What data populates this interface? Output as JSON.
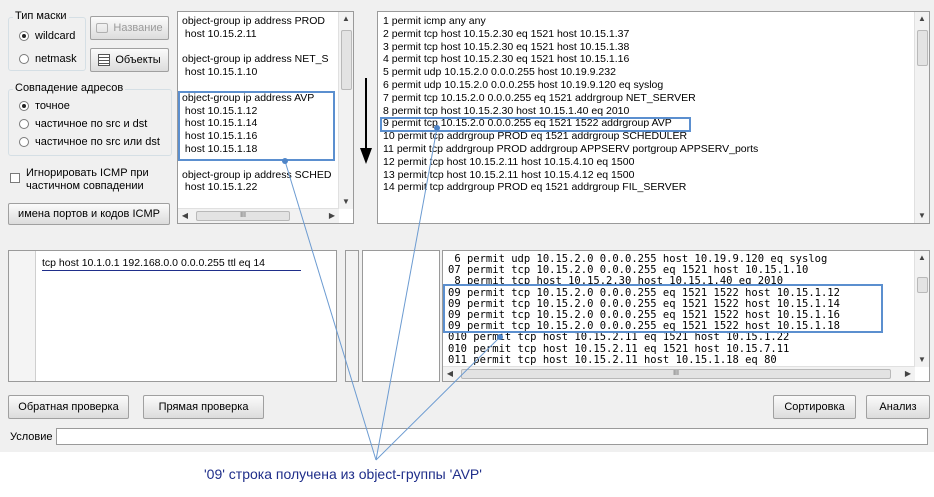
{
  "mask_group": {
    "title": "Тип маски",
    "options": [
      "wildcard",
      "netmask"
    ],
    "selected": "wildcard"
  },
  "buttons": {
    "name": "Название",
    "objects": "Объекты",
    "port_names": "имена портов и кодов ICMP",
    "reverse_check": "Обратная проверка",
    "direct_check": "Прямая проверка",
    "sort": "Сортировка",
    "analysis": "Анализ"
  },
  "address_group": {
    "title": "Совпадение адресов",
    "options": [
      "точное",
      "частичное по src и dst",
      "частичное по src или dst"
    ],
    "selected": "точное"
  },
  "icmp_checkbox": {
    "line1": "Игнорировать ICMP при",
    "line2": "частичном совпадении",
    "checked": false
  },
  "object_groups": [
    "object-group ip address PROD",
    " host 10.15.2.11",
    "",
    "object-group ip address NET_S",
    " host 10.15.1.10",
    "",
    "object-group ip address AVP",
    " host 10.15.1.12",
    " host 10.15.1.14",
    " host 10.15.1.16",
    " host 10.15.1.18",
    "",
    "object-group ip address SCHED",
    " host 10.15.1.22"
  ],
  "acl_lines": [
    "1 permit icmp any any",
    "2 permit tcp host 10.15.2.30 eq 1521 host 10.15.1.37",
    "3 permit tcp host 10.15.2.30 eq 1521 host 10.15.1.38",
    "4 permit tcp host 10.15.2.30 eq 1521 host 10.15.1.16",
    "5 permit udp 10.15.2.0 0.0.0.255 host 10.19.9.232",
    "6 permit udp 10.15.2.0 0.0.0.255 host 10.19.9.120 eq syslog",
    "7 permit tcp 10.15.2.0 0.0.0.255 eq 1521 addrgroup NET_SERVER",
    "8 permit tcp host 10.15.2.30 host 10.15.1.40 eq 2010",
    "9 permit tcp 10.15.2.0 0.0.0.255 eq 1521 1522 addrgroup AVP",
    "10 permit tcp addrgroup PROD eq 1521 addrgroup SCHEDULER",
    "11 permit tcp addrgroup PROD addrgroup APPSERV portgroup APPSERV_ports",
    "12 permit tcp host 10.15.2.11 host 10.15.4.10 eq 1500",
    "13 permit tcp host 10.15.2.11 host 10.15.4.12 eq 1500",
    "14 permit tcp addrgroup PROD eq 1521 addrgroup FIL_SERVER"
  ],
  "input_lines": [
    "tcp host 10.1.0.1 192.168.0.0 0.0.0.255 ttl eq 14"
  ],
  "expanded_lines": [
    " 6 permit udp 10.15.2.0 0.0.0.255 host 10.19.9.120 eq syslog",
    "07 permit tcp 10.15.2.0 0.0.0.255 eq 1521 host 10.15.1.10",
    " 8 permit tcp host 10.15.2.30 host 10.15.1.40 eq 2010",
    "09 permit tcp 10.15.2.0 0.0.0.255 eq 1521 1522 host 10.15.1.12",
    "09 permit tcp 10.15.2.0 0.0.0.255 eq 1521 1522 host 10.15.1.14",
    "09 permit tcp 10.15.2.0 0.0.0.255 eq 1521 1522 host 10.15.1.16",
    "09 permit tcp 10.15.2.0 0.0.0.255 eq 1521 1522 host 10.15.1.18",
    "010 permit tcp host 10.15.2.11 eq 1521 host 10.15.1.22",
    "010 permit tcp host 10.15.2.11 eq 1521 host 10.15.7.11",
    "011 permit tcp host 10.15.2.11 host 10.15.1.18 eq 80"
  ],
  "condition": {
    "label": "Условие",
    "value": ""
  },
  "annotation": "'09' строка получена из object-группы 'AVP'",
  "colors": {
    "highlight": "#5b8fcf",
    "annotation_text": "#1f2e8a",
    "arrow": "#000000"
  },
  "icons": {
    "name_button": "tag-icon",
    "objects_button": "list-icon",
    "down_arrow": "arrow-down-icon"
  }
}
